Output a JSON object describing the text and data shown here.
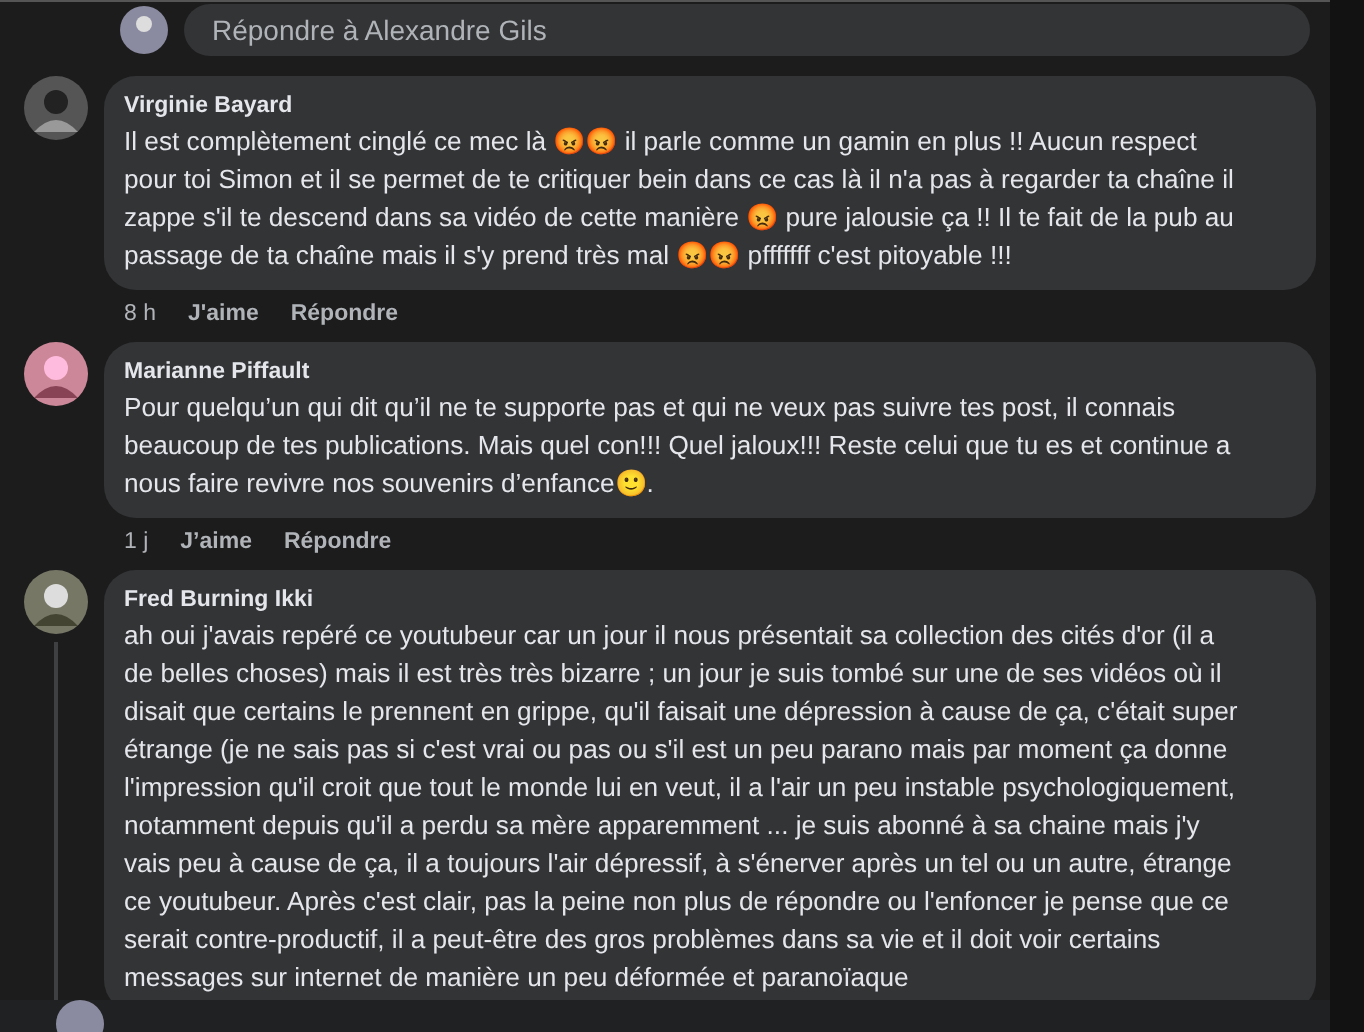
{
  "reply_composer": {
    "placeholder": "Répondre à Alexandre Gils"
  },
  "comments": [
    {
      "author": "Virginie Bayard",
      "text": "Il est complètement cinglé ce mec là 😡😡 il parle comme un gamin en plus !! Aucun respect pour toi Simon et il se permet de te critiquer bein dans ce cas là il n'a pas à regarder ta chaîne il zappe s'il te descend dans sa vidéo de cette manière 😡 pure jalousie ça !! Il te fait de la pub au passage de ta chaîne mais il s'y prend très mal 😡😡 pfffffff c'est pitoyable !!!",
      "time": "8 h",
      "like": "J'aime",
      "reply": "Répondre",
      "has_thread": false
    },
    {
      "author": "Marianne Piffault",
      "text": "Pour quelqu’un qui dit qu’il ne te supporte pas et qui ne veux pas suivre tes post, il connais beaucoup de tes publications. Mais quel con!!! Quel jaloux!!! Reste celui que tu es et continue a nous faire revivre nos souvenirs d’enfance🙂.",
      "time": "1 j",
      "like": "J’aime",
      "reply": "Répondre",
      "has_thread": false
    },
    {
      "author": "Fred Burning Ikki",
      "text": "ah oui j'avais repéré ce youtubeur car un jour il nous présentait sa collection des cités d'or (il a de belles choses) mais il est très très bizarre ; un jour je suis tombé sur une de ses vidéos où il disait que certains le prennent en grippe, qu'il faisait une dépression à cause de ça, c'était super étrange (je ne sais pas si c'est vrai ou pas ou s'il est un peu parano mais par moment ça donne l'impression qu'il croit que tout le monde lui en veut, il a l'air un peu instable psychologiquement, notamment depuis qu'il a perdu sa mère apparemment ... je suis abonné à sa chaine mais j'y vais peu à cause de ça, il a toujours l'air dépressif, à s'énerver après un tel ou un autre, étrange ce youtubeur. Après c'est clair, pas la peine non plus de répondre ou l'enfoncer je pense que ce serait contre-productif, il a peut-être des gros problèmes dans sa vie et il doit voir certains messages sur internet de manière un peu déformée et paranoïaque",
      "has_thread": true
    }
  ]
}
